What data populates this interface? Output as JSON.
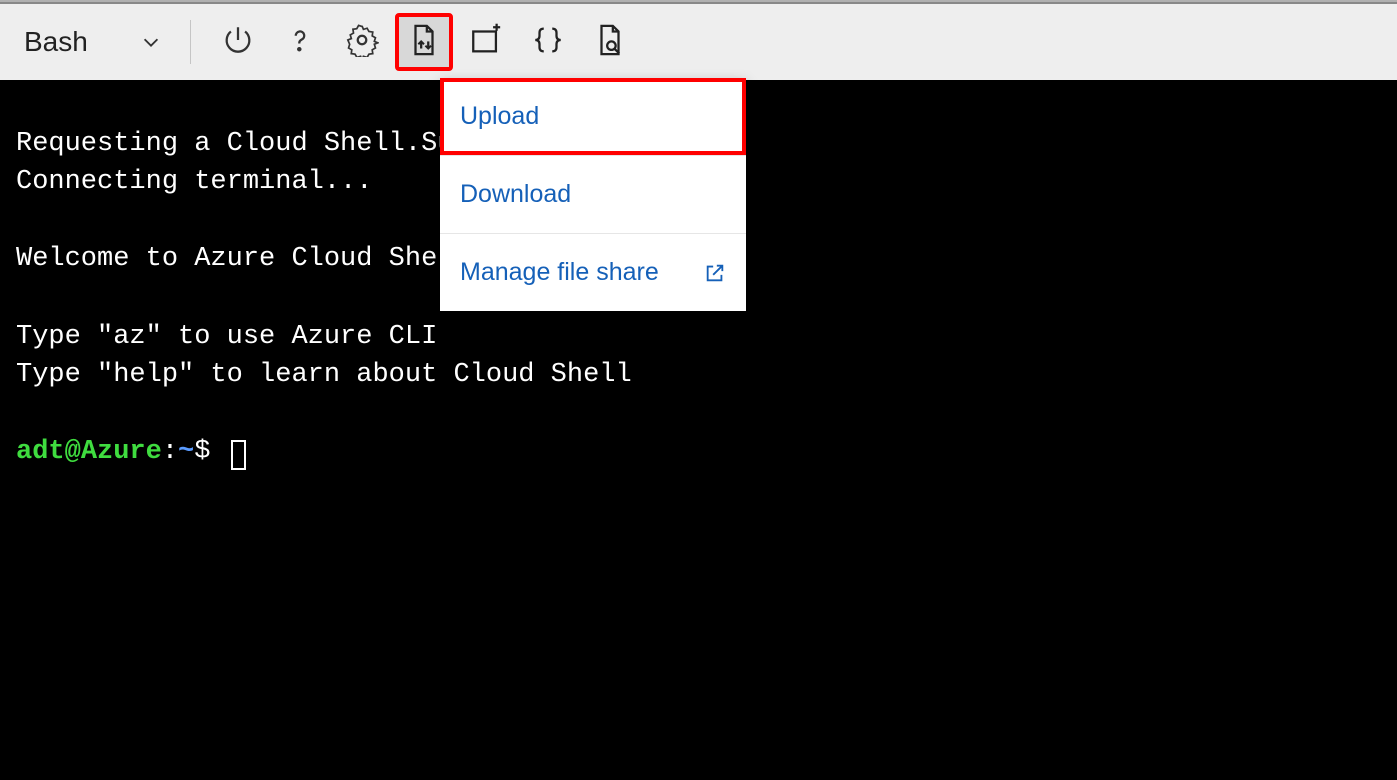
{
  "toolbar": {
    "shell_name": "Bash",
    "icons": {
      "power": "power-icon",
      "help": "help-icon",
      "settings": "settings-icon",
      "files": "files-icon",
      "new_session": "new-session-icon",
      "editor": "editor-icon",
      "preview": "preview-icon"
    }
  },
  "dropdown": {
    "items": [
      {
        "label": "Upload",
        "external": false,
        "highlight": true
      },
      {
        "label": "Download",
        "external": false,
        "highlight": false
      },
      {
        "label": "Manage file share",
        "external": true,
        "highlight": false
      }
    ]
  },
  "terminal": {
    "lines": [
      "Requesting a Cloud Shell.Succeeded.",
      "Connecting terminal...",
      "",
      "Welcome to Azure Cloud Shell",
      "",
      "Type \"az\" to use Azure CLI",
      "Type \"help\" to learn about Cloud Shell",
      ""
    ],
    "prompt": {
      "user": "adt",
      "host": "Azure",
      "path": "~",
      "symbol": "$"
    }
  }
}
